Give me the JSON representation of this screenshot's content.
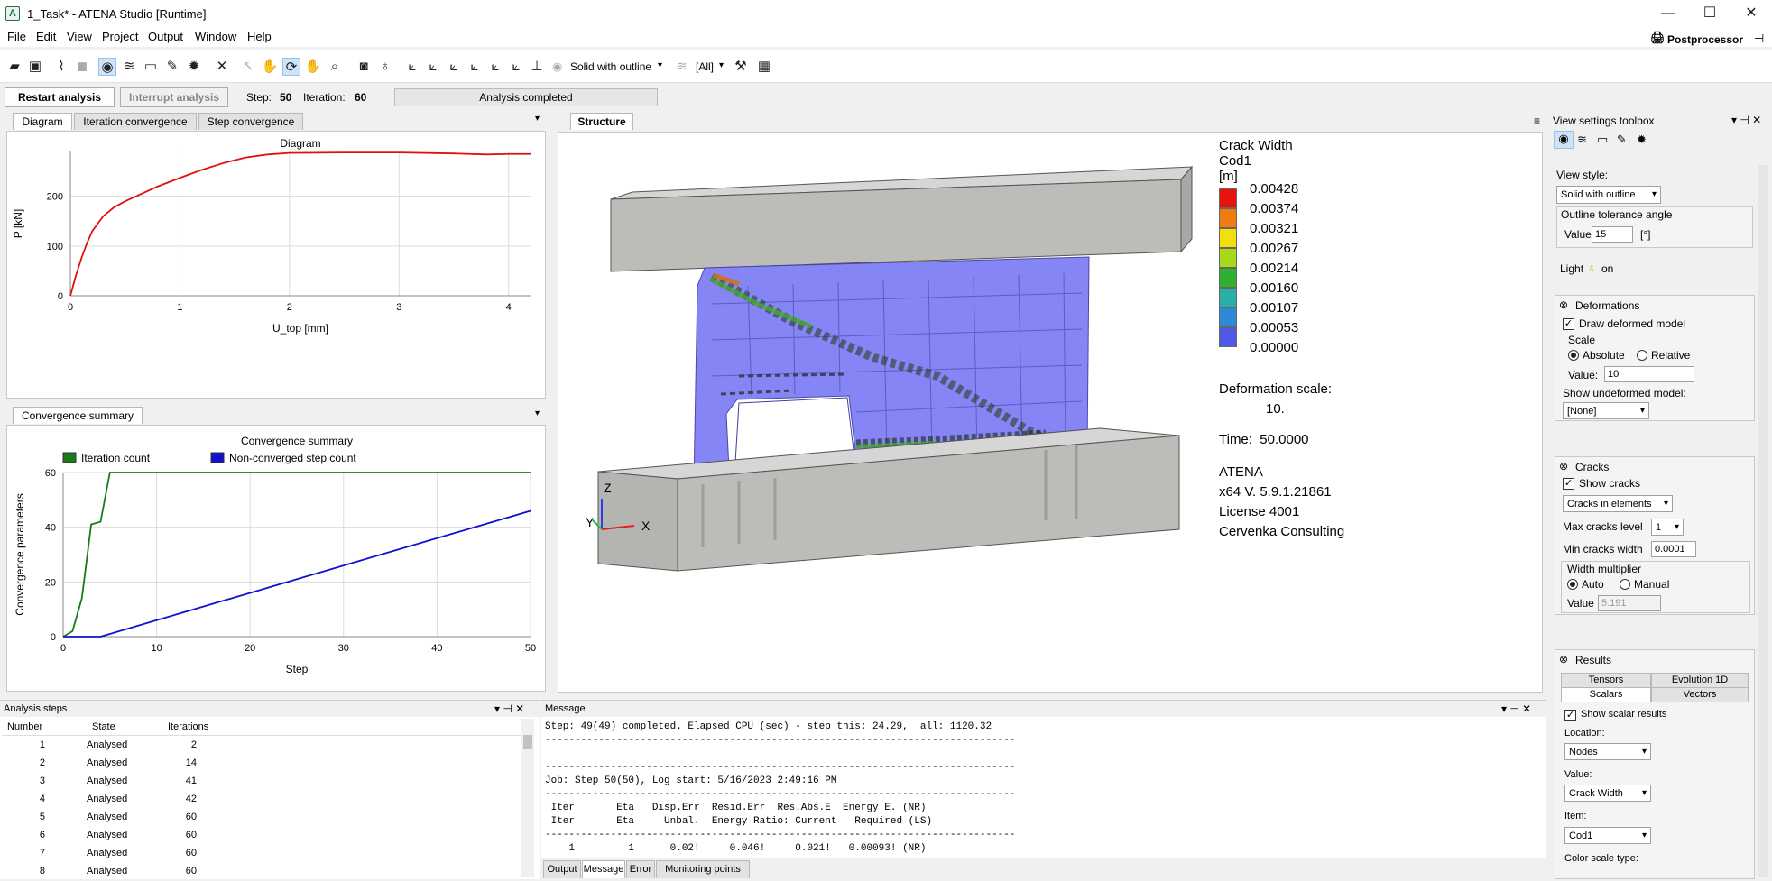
{
  "window": {
    "title": "1_Task* - ATENA Studio [Runtime]",
    "minimize": "—",
    "maximize": "☐",
    "close": "✕"
  },
  "menu": [
    "File",
    "Edit",
    "View",
    "Project",
    "Output",
    "Window",
    "Help"
  ],
  "postprocessor": {
    "label": "Postprocessor",
    "pin": "⊣"
  },
  "toolbar": {
    "view_style": "Solid with outline",
    "layers": "[All]"
  },
  "controls": {
    "restart": "Restart analysis",
    "interrupt": "Interrupt analysis",
    "step_label": "Step:",
    "step_value": "50",
    "iter_label": "Iteration:",
    "iter_value": "60",
    "status": "Analysis completed"
  },
  "diagram_panel": {
    "tabs": [
      "Diagram",
      "Iteration convergence",
      "Step convergence"
    ]
  },
  "chart_data": [
    {
      "type": "line",
      "title": "Diagram",
      "xlabel": "U_top [mm]",
      "ylabel": "P [kN]",
      "xlim": [
        0,
        4.2
      ],
      "ylim": [
        0,
        290
      ],
      "xticks": [
        "0",
        "1",
        "2",
        "3",
        "4"
      ],
      "yticks": [
        "0",
        "100",
        "200"
      ],
      "grid": true,
      "series": [
        {
          "color": "#e01010",
          "x": [
            0,
            0.05,
            0.1,
            0.15,
            0.2,
            0.3,
            0.4,
            0.5,
            0.6,
            0.8,
            1.0,
            1.2,
            1.4,
            1.6,
            1.8,
            2.0,
            2.5,
            3.0,
            3.5,
            3.8,
            4.0,
            4.2
          ],
          "y": [
            0,
            40,
            75,
            105,
            130,
            160,
            178,
            190,
            200,
            220,
            237,
            253,
            267,
            278,
            284,
            287,
            288,
            288,
            286,
            284,
            285,
            285
          ]
        }
      ]
    },
    {
      "type": "line",
      "title": "Convergence summary",
      "xlabel": "Step",
      "ylabel": "Convergence parameters",
      "xlim": [
        0,
        50
      ],
      "ylim": [
        0,
        60
      ],
      "xticks": [
        "0",
        "10",
        "20",
        "30",
        "40",
        "50"
      ],
      "yticks": [
        "0",
        "20",
        "40",
        "60"
      ],
      "grid": true,
      "legend": "top-left",
      "series": [
        {
          "name": "Iteration count",
          "color": "#1a7a1a",
          "x": [
            0,
            1,
            2,
            3,
            4,
            5,
            10,
            20,
            30,
            40,
            50
          ],
          "y": [
            0,
            2,
            14,
            41,
            42,
            60,
            60,
            60,
            60,
            60,
            60
          ]
        },
        {
          "name": "Non-converged step count",
          "color": "#1010d0",
          "x": [
            0,
            4,
            50
          ],
          "y": [
            0,
            0,
            46
          ]
        }
      ]
    }
  ],
  "convergence_panel": {
    "tab": "Convergence summary"
  },
  "structure": {
    "tab": "Structure",
    "legend_title": [
      "Crack Width",
      "Cod1",
      "[m]"
    ],
    "legend_values": [
      "0.00428",
      "0.00374",
      "0.00321",
      "0.00267",
      "0.00214",
      "0.00160",
      "0.00107",
      "0.00053",
      "0.00000"
    ],
    "legend_colors": [
      "#e8140c",
      "#f07c10",
      "#f0e010",
      "#a8d818",
      "#30b030",
      "#28b0a8",
      "#3088d8",
      "#5058e8",
      "#7070f8"
    ],
    "deform_label": "Deformation scale:",
    "deform_value": "10.",
    "time": "Time:  50.0000",
    "info": [
      "ATENA",
      "x64 V. 5.9.1.21861",
      "License 4001",
      "Cervenka Consulting"
    ],
    "axis": {
      "z": "Z",
      "y": "Y",
      "x": "X"
    }
  },
  "toolbox": {
    "title": "View settings toolbox",
    "view_style_label": "View style:",
    "view_style": "Solid with outline",
    "outline_label": "Outline tolerance angle",
    "outline_value_label": "Value",
    "outline_value": "15",
    "outline_unit": "[°]",
    "light_label": "Light",
    "light_state": "on",
    "deformations": {
      "header": "Deformations",
      "draw": "Draw deformed model",
      "scale": "Scale",
      "absolute": "Absolute",
      "relative": "Relative",
      "value_label": "Value:",
      "value": "10",
      "undeformed_label": "Show undeformed model:",
      "undeformed": "[None]"
    },
    "cracks": {
      "header": "Cracks",
      "show": "Show cracks",
      "mode": "Cracks in elements",
      "max_label": "Max cracks level",
      "max": "1",
      "min_label": "Min cracks width",
      "min": "0.0001",
      "mult": "Width multiplier",
      "auto": "Auto",
      "manual": "Manual",
      "value_label": "Value",
      "value": "5.191"
    },
    "results": {
      "header": "Results",
      "tabs": [
        "Tensors",
        "Evolution 1D",
        "Scalars",
        "Vectors"
      ],
      "show": "Show scalar results",
      "location_label": "Location:",
      "location": "Nodes",
      "value_label": "Value:",
      "value": "Crack Width",
      "item_label": "Item:",
      "item": "Cod1",
      "color_label": "Color scale type:"
    }
  },
  "steps": {
    "title": "Analysis steps",
    "headers": [
      "Number",
      "State",
      "Iterations"
    ],
    "rows": [
      [
        "1",
        "Analysed",
        "2"
      ],
      [
        "2",
        "Analysed",
        "14"
      ],
      [
        "3",
        "Analysed",
        "41"
      ],
      [
        "4",
        "Analysed",
        "42"
      ],
      [
        "5",
        "Analysed",
        "60"
      ],
      [
        "6",
        "Analysed",
        "60"
      ],
      [
        "7",
        "Analysed",
        "60"
      ],
      [
        "8",
        "Analysed",
        "60"
      ]
    ]
  },
  "message": {
    "title": "Message",
    "lines": [
      "Step: 49(49) completed. Elapsed CPU (sec) - step this: 24.29,  all: 1120.32",
      "-------------------------------------------------------------------------------",
      "",
      "-------------------------------------------------------------------------------",
      "Job: Step 50(50), Log start: 5/16/2023 2:49:16 PM",
      "-------------------------------------------------------------------------------",
      " Iter       Eta   Disp.Err  Resid.Err  Res.Abs.E  Energy E. (NR)",
      " Iter       Eta     Unbal.  Energy Ratio: Current   Required (LS)",
      "-------------------------------------------------------------------------------",
      "    1         1      0.02!     0.046!     0.021!   0.00093! (NR)"
    ],
    "tabs": [
      "Output",
      "Message",
      "Error",
      "Monitoring points"
    ]
  }
}
